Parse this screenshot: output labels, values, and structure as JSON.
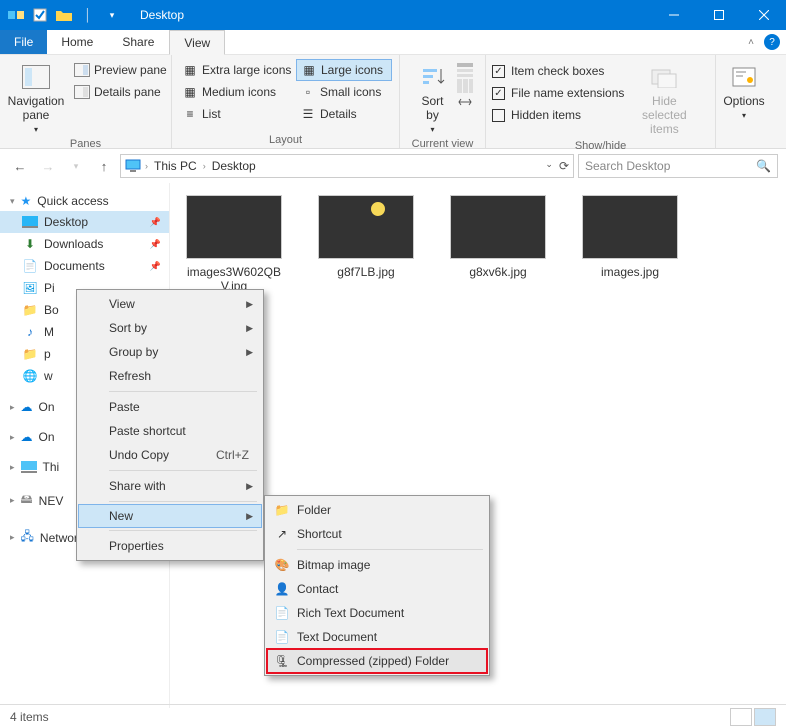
{
  "window": {
    "title": "Desktop"
  },
  "tabs": {
    "file": "File",
    "home": "Home",
    "share": "Share",
    "view": "View"
  },
  "ribbon": {
    "panes": {
      "nav": "Navigation pane",
      "preview": "Preview pane",
      "details": "Details pane",
      "group": "Panes"
    },
    "layout": {
      "xl": "Extra large icons",
      "lg": "Large icons",
      "md": "Medium icons",
      "sm": "Small icons",
      "list": "List",
      "det": "Details",
      "group": "Layout"
    },
    "curview": {
      "sort": "Sort by",
      "group": "Current view"
    },
    "showhide": {
      "chk1": "Item check boxes",
      "chk2": "File name extensions",
      "chk3": "Hidden items",
      "hide": "Hide selected items",
      "group": "Show/hide"
    },
    "options": "Options"
  },
  "breadcrumb": {
    "pc": "This PC",
    "loc": "Desktop"
  },
  "search": {
    "placeholder": "Search Desktop"
  },
  "sidebar": {
    "quick": "Quick access",
    "desktop": "Desktop",
    "downloads": "Downloads",
    "documents": "Documents",
    "pi": "Pi",
    "bo": "Bo",
    "mu": "M",
    "pf": "p",
    "w": "w",
    "on1": "On",
    "on2": "On",
    "thispc": "Thi",
    "nev": "NEV",
    "network": "Network"
  },
  "files": [
    {
      "name": "images3W602QBV.jpg"
    },
    {
      "name": "g8f7LB.jpg"
    },
    {
      "name": "g8xv6k.jpg"
    },
    {
      "name": "images.jpg"
    }
  ],
  "ctx1": {
    "view": "View",
    "sort": "Sort by",
    "group": "Group by",
    "refresh": "Refresh",
    "paste": "Paste",
    "pastesc": "Paste shortcut",
    "undo": "Undo Copy",
    "undosc": "Ctrl+Z",
    "share": "Share with",
    "new": "New",
    "props": "Properties"
  },
  "ctx2": {
    "folder": "Folder",
    "shortcut": "Shortcut",
    "bmp": "Bitmap image",
    "contact": "Contact",
    "rtf": "Rich Text Document",
    "txt": "Text Document",
    "zip": "Compressed (zipped) Folder"
  },
  "status": {
    "items": "4 items"
  }
}
